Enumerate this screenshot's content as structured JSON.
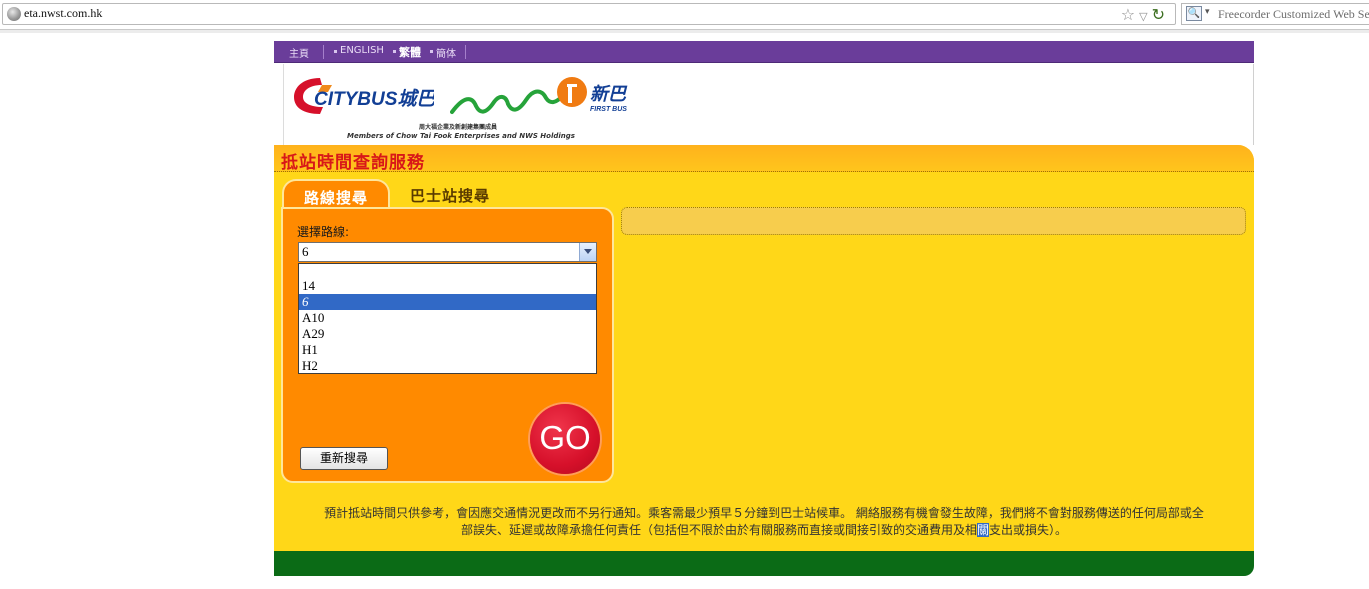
{
  "browser": {
    "url": "eta.nwst.com.hk",
    "search_placeholder": "Freecorder Customized Web Sea",
    "icons": [
      "globe-icon",
      "star-icon",
      "dropdown-icon",
      "reload-icon",
      "search-engine-icon"
    ]
  },
  "nav": {
    "home": "主頁",
    "english": "ENGLISH",
    "traditional": "繁體",
    "simplified": "簡体"
  },
  "logo": {
    "citybus": "CITYBUS城巴",
    "firstbus": "新巴",
    "firstbus_en": "FIRST BUS",
    "members_cn": "周大福企業及新創建集團成員",
    "members_en": "Members of Chow Tai Fook Enterprises and NWS Holdings"
  },
  "header": {
    "title": "抵站時間查詢服務"
  },
  "tabs": {
    "route_search": "路線搜尋",
    "stop_search": "巴士站搜尋"
  },
  "search": {
    "route_label": "選擇路線:",
    "selected_route": "6",
    "options": [
      "",
      "14",
      "6",
      "A10",
      "A29",
      "H1",
      "H2"
    ],
    "selected_index": 2,
    "reset_label": "重新搜尋",
    "go_label": "GO"
  },
  "disclaimer": {
    "line1": "預計抵站時間只供參考，會因應交通情況更改而不另行通知。乘客需最少預早５分鐘到巴士站候車。 網絡服務有機會發生故障，我們將不會對服務傳送的任何局部或全",
    "line2_before": "部誤失、延遲或故障承擔任何責任（包括但不限於由於有關服務而直接或間接引致的交通費用及相",
    "line2_highlight": "關",
    "line2_after": "支出或損失）。"
  },
  "colors": {
    "nav_purple": "#6a3d9a",
    "main_yellow": "#ffd718",
    "panel_orange": "#ff8a00",
    "title_red": "#d81818",
    "go_red": "#d6102a",
    "footer_green": "#0b6b16",
    "selection_blue": "#3169c6"
  }
}
